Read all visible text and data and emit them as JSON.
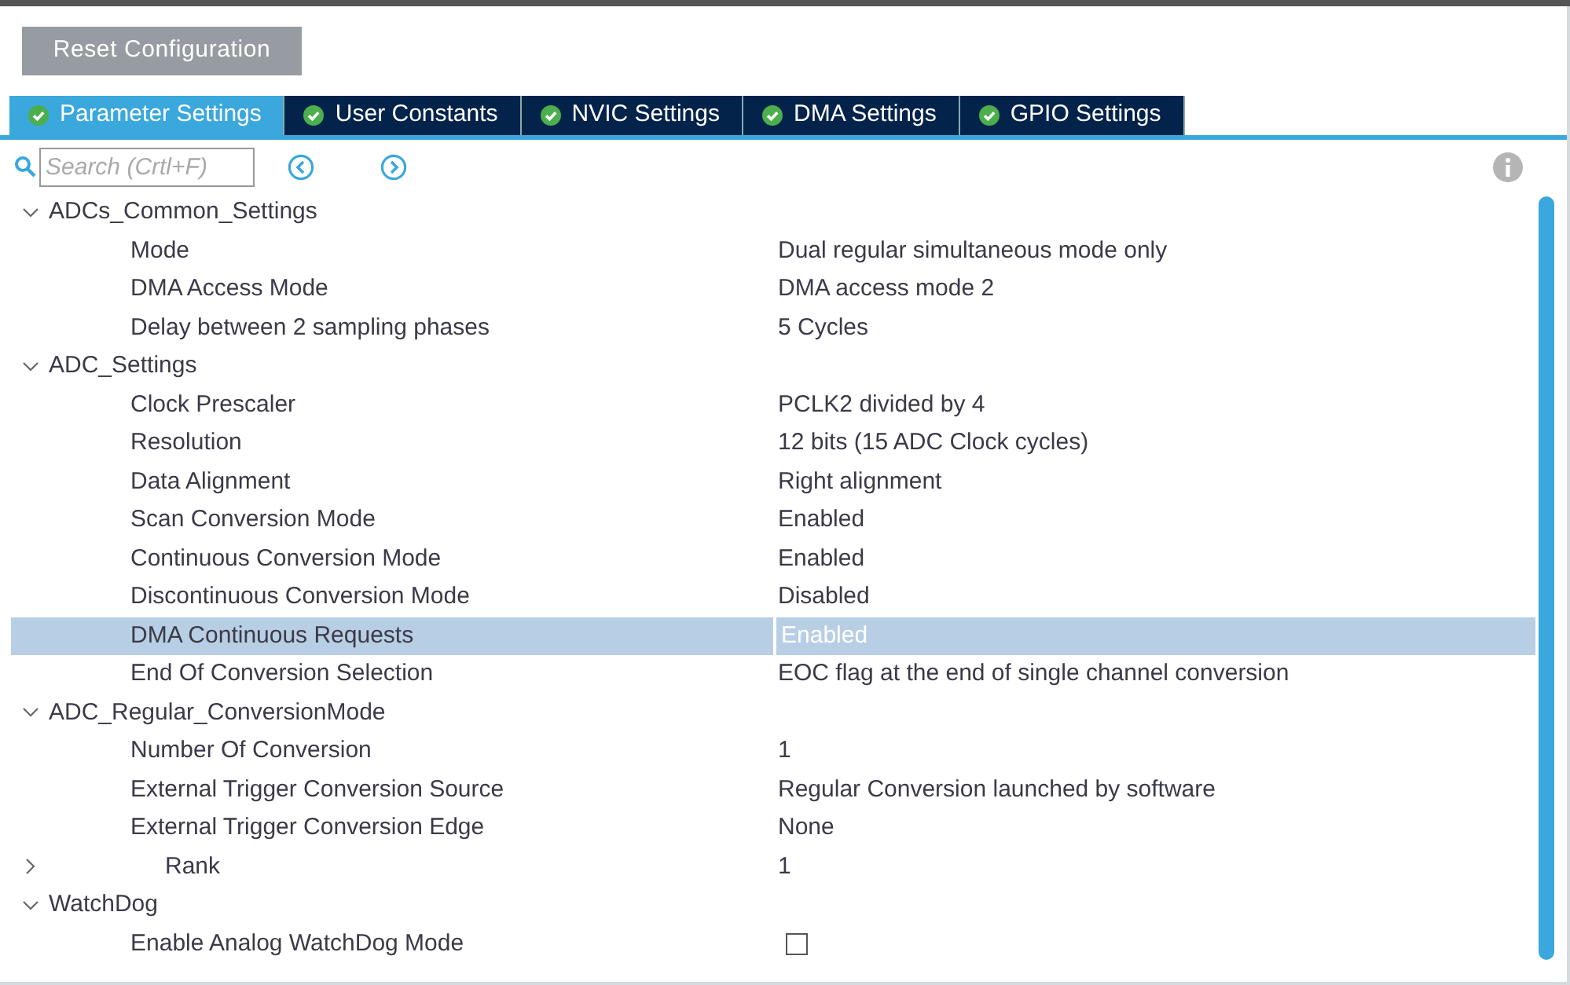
{
  "reset_button": "Reset Configuration",
  "tabs": [
    {
      "label": "Parameter Settings",
      "selected": true
    },
    {
      "label": "User Constants",
      "selected": false
    },
    {
      "label": "NVIC Settings",
      "selected": false
    },
    {
      "label": "DMA Settings",
      "selected": false
    },
    {
      "label": "GPIO Settings",
      "selected": false
    }
  ],
  "search": {
    "placeholder": "Search (Crtl+F)"
  },
  "groups": [
    {
      "label": "ADCs_Common_Settings",
      "expanded": true,
      "children": [
        {
          "label": "Mode",
          "value": "Dual regular simultaneous mode only",
          "kind": "value",
          "selected": false
        },
        {
          "label": "DMA Access Mode",
          "value": "DMA access mode 2",
          "kind": "value",
          "selected": false
        },
        {
          "label": "Delay between 2 sampling phases",
          "value": "5 Cycles",
          "kind": "value",
          "selected": false
        }
      ]
    },
    {
      "label": "ADC_Settings",
      "expanded": true,
      "children": [
        {
          "label": "Clock Prescaler",
          "value": "PCLK2 divided by 4",
          "kind": "value",
          "selected": false
        },
        {
          "label": "Resolution",
          "value": "12 bits (15 ADC Clock cycles)",
          "kind": "value",
          "selected": false
        },
        {
          "label": "Data Alignment",
          "value": "Right alignment",
          "kind": "value",
          "selected": false
        },
        {
          "label": "Scan Conversion Mode",
          "value": "Enabled",
          "kind": "value",
          "selected": false
        },
        {
          "label": "Continuous Conversion Mode",
          "value": "Enabled",
          "kind": "value",
          "selected": false
        },
        {
          "label": "Discontinuous Conversion Mode",
          "value": "Disabled",
          "kind": "value",
          "selected": false
        },
        {
          "label": "DMA Continuous Requests",
          "value": "Enabled",
          "kind": "value",
          "selected": true
        },
        {
          "label": "End Of Conversion Selection",
          "value": "EOC flag at the end of single channel conversion",
          "kind": "value",
          "selected": false
        }
      ]
    },
    {
      "label": "ADC_Regular_ConversionMode",
      "expanded": true,
      "children": [
        {
          "label": "Number Of Conversion",
          "value": "1",
          "kind": "value",
          "selected": false
        },
        {
          "label": "External Trigger Conversion Source",
          "value": "Regular Conversion launched by software",
          "kind": "value",
          "selected": false
        },
        {
          "label": "External Trigger Conversion Edge",
          "value": "None",
          "kind": "value",
          "selected": false
        },
        {
          "label": "Rank",
          "value": "1",
          "kind": "branch",
          "expanded": false,
          "selected": false
        }
      ]
    },
    {
      "label": "WatchDog",
      "expanded": true,
      "children": [
        {
          "label": "Enable Analog WatchDog Mode",
          "kind": "checkbox",
          "checked": false,
          "selected": false
        }
      ]
    }
  ]
}
